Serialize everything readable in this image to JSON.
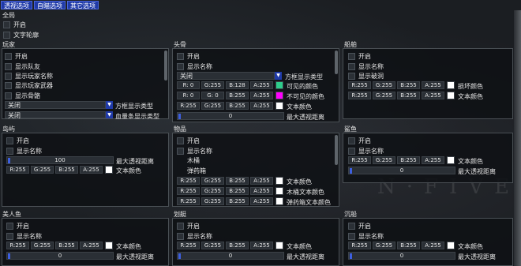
{
  "tabs": [
    "透视选项",
    "自瞄选项",
    "其它选项"
  ],
  "global": {
    "title": "全局",
    "enable": "开启",
    "text_outline": "文字轮廓"
  },
  "player": {
    "title": "玩家",
    "checks": [
      "开启",
      "显示队友",
      "显示玩家名称",
      "显示玩家武器",
      "显示骨骼"
    ],
    "box_type_value": "关闭",
    "box_type_label": "方框显示类型",
    "hp_type_value": "关闭",
    "hp_type_label": "血量条显示类型"
  },
  "skull": {
    "title": "头骨",
    "checks": [
      "开启",
      "显示名称"
    ],
    "box_type_value": "关闭",
    "box_type_label": "方框显示类型",
    "rows": [
      {
        "r": "R:  0",
        "g": "G:255",
        "b": "B:128",
        "a": "A:255",
        "color": "#2ecc8a",
        "label": "可见的颜色"
      },
      {
        "r": "R:  0",
        "g": "G:  0",
        "b": "B:255",
        "a": "A:255",
        "color": "#ff00ff",
        "label": "不可见的颜色"
      },
      {
        "r": "R:255",
        "g": "G:255",
        "b": "B:255",
        "a": "A:255",
        "color": "#ffffff",
        "label": "文本颜色"
      }
    ],
    "distance_value": "0",
    "distance_label": "最大透视距离"
  },
  "ship": {
    "title": "船舶",
    "checks": [
      "开启",
      "显示名称",
      "显示破洞"
    ],
    "rows": [
      {
        "r": "R:255",
        "g": "G:255",
        "b": "B:255",
        "a": "A:255",
        "color": "#ffffff",
        "label": "损坏颜色"
      },
      {
        "r": "R:255",
        "g": "G:255",
        "b": "B:255",
        "a": "A:255",
        "color": "#ffffff",
        "label": "文本颜色"
      }
    ]
  },
  "island": {
    "title": "岛屿",
    "checks": [
      "开启",
      "显示名称"
    ],
    "distance_value": "100",
    "distance_label": "最大透视距离",
    "row": {
      "r": "R:255",
      "g": "G:255",
      "b": "B:255",
      "a": "A:255",
      "color": "#ffffff",
      "label": "文本颜色"
    }
  },
  "items": {
    "title": "物品",
    "checks": [
      "开启",
      "显示名称",
      "木桶",
      "弹药箱"
    ],
    "rows": [
      {
        "r": "R:255",
        "g": "G:255",
        "b": "B:255",
        "a": "A:255",
        "color": "#ffffff",
        "label": "文本颜色"
      },
      {
        "r": "R:255",
        "g": "G:255",
        "b": "B:255",
        "a": "A:255",
        "color": "#ffffff",
        "label": "木桶文本颜色"
      },
      {
        "r": "R:255",
        "g": "G:255",
        "b": "B:255",
        "a": "A:255",
        "color": "#ffffff",
        "label": "弹药箱文本颜色"
      }
    ]
  },
  "shark": {
    "title": "鲨鱼",
    "checks": [
      "开启",
      "显示名称"
    ],
    "row": {
      "r": "R:255",
      "g": "G:255",
      "b": "B:255",
      "a": "A:255",
      "color": "#ffffff",
      "label": "文本颜色"
    },
    "distance_value": "0",
    "distance_label": "最大透视距离"
  },
  "mermaid": {
    "title": "美人鱼",
    "checks": [
      "开启",
      "显示名称"
    ],
    "row": {
      "r": "R:255",
      "g": "G:255",
      "b": "B:255",
      "a": "A:255",
      "color": "#ffffff",
      "label": "文本颜色"
    },
    "distance_value": "0",
    "distance_label": "最大透视距离"
  },
  "rowboat": {
    "title": "划艇",
    "checks": [
      "开启",
      "显示名称"
    ],
    "row": {
      "r": "R:255",
      "g": "G:255",
      "b": "B:255",
      "a": "A:255",
      "color": "#ffffff",
      "label": "文本颜色"
    },
    "distance_value": "0",
    "distance_label": "最大透视距离"
  },
  "shipwreck": {
    "title": "沉船",
    "checks": [
      "开启",
      "显示名称"
    ],
    "row": {
      "r": "R:255",
      "g": "G:255",
      "b": "B:255",
      "a": "A:255",
      "color": "#ffffff",
      "label": "文本颜色"
    },
    "distance_value": "0",
    "distance_label": "最大透视距离"
  },
  "watermark": "N·FIVE",
  "colors": {
    "accent": "#1f3aa8",
    "slider_grab": "#3d5fe0"
  }
}
